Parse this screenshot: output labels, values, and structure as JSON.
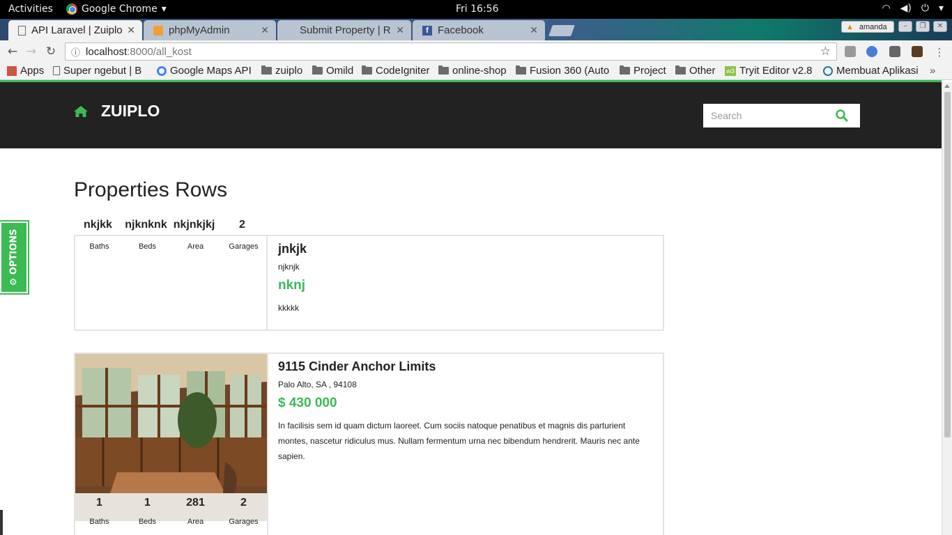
{
  "topbar": {
    "activities": "Activities",
    "app_name": "Google Chrome",
    "clock": "Fri 16:56"
  },
  "tabs": [
    {
      "title": "API Laravel | Zuiplo"
    },
    {
      "title": "phpMyAdmin"
    },
    {
      "title": "Submit Property | R"
    },
    {
      "title": "Facebook"
    }
  ],
  "profile": {
    "name": "amanda"
  },
  "address": {
    "host": "localhost",
    "path": ":8000/all_kost"
  },
  "bookmarks": [
    {
      "label": "Apps",
      "icon": "apps-grid-icon"
    },
    {
      "label": "Super ngebut | B",
      "icon": "page-icon"
    },
    {
      "label": "Google Maps API",
      "icon": "google-icon"
    },
    {
      "label": "zuiplo",
      "icon": "folder-icon"
    },
    {
      "label": "Omild",
      "icon": "folder-icon"
    },
    {
      "label": "CodeIgniter",
      "icon": "folder-icon"
    },
    {
      "label": "online-shop",
      "icon": "folder-icon"
    },
    {
      "label": "Fusion 360 (Auto",
      "icon": "folder-icon"
    },
    {
      "label": "Project",
      "icon": "folder-icon"
    },
    {
      "label": "Other",
      "icon": "folder-icon"
    },
    {
      "label": "Tryit Editor v2.8",
      "icon": "w3-icon"
    },
    {
      "label": "Membuat Aplikasi",
      "icon": "wordpress-icon"
    }
  ],
  "site": {
    "brand": "ZUIPLO",
    "search_placeholder": "Search",
    "heading": "Properties Rows",
    "options_label": "OPTIONS",
    "accent": "#3cba54",
    "header_bg": "#222222"
  },
  "properties": [
    {
      "title": "jnkjk",
      "address": "njknjk",
      "price": "nknj",
      "description": "kkkkk",
      "stats": [
        {
          "value": "nkjkk",
          "label": "Baths"
        },
        {
          "value": "njknknk",
          "label": "Beds"
        },
        {
          "value": "nkjnkjkj",
          "label": "Area"
        },
        {
          "value": "2",
          "label": "Garages"
        }
      ]
    },
    {
      "title": "9115 Cinder Anchor Limits",
      "address": "Palo Alto, SA , 94108",
      "price": "$ 430 000",
      "description": "In facilisis sem id quam dictum laoreet. Cum sociis natoque penatibus et magnis dis parturient montes, nascetur ridiculus mus. Nullam fermentum urna nec bibendum hendrerit. Mauris nec ante sapien.",
      "stats": [
        {
          "value": "1",
          "label": "Baths"
        },
        {
          "value": "1",
          "label": "Beds"
        },
        {
          "value": "281",
          "label": "Area"
        },
        {
          "value": "2",
          "label": "Garages"
        }
      ]
    }
  ]
}
